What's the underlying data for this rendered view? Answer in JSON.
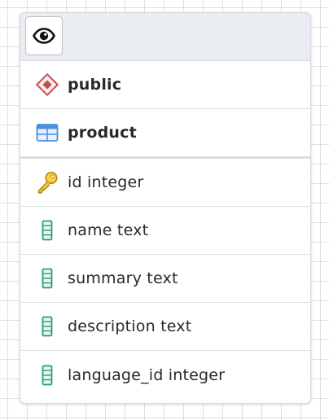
{
  "toolbar": {
    "eye_icon": "eye-icon"
  },
  "schema": {
    "label": "public",
    "icon": "schema-diamond-icon",
    "color": "#c0504d"
  },
  "table": {
    "label": "product",
    "icon": "table-grid-icon",
    "color": "#4a90d9"
  },
  "columns": [
    {
      "label": "id integer",
      "icon": "primary-key-icon",
      "color": "#d9a520"
    },
    {
      "label": "name text",
      "icon": "column-icon",
      "color": "#2a9d78"
    },
    {
      "label": "summary text",
      "icon": "column-icon",
      "color": "#2a9d78"
    },
    {
      "label": "description text",
      "icon": "column-icon",
      "color": "#2a9d78"
    },
    {
      "label": "language_id integer",
      "icon": "column-icon",
      "color": "#2a9d78"
    }
  ]
}
